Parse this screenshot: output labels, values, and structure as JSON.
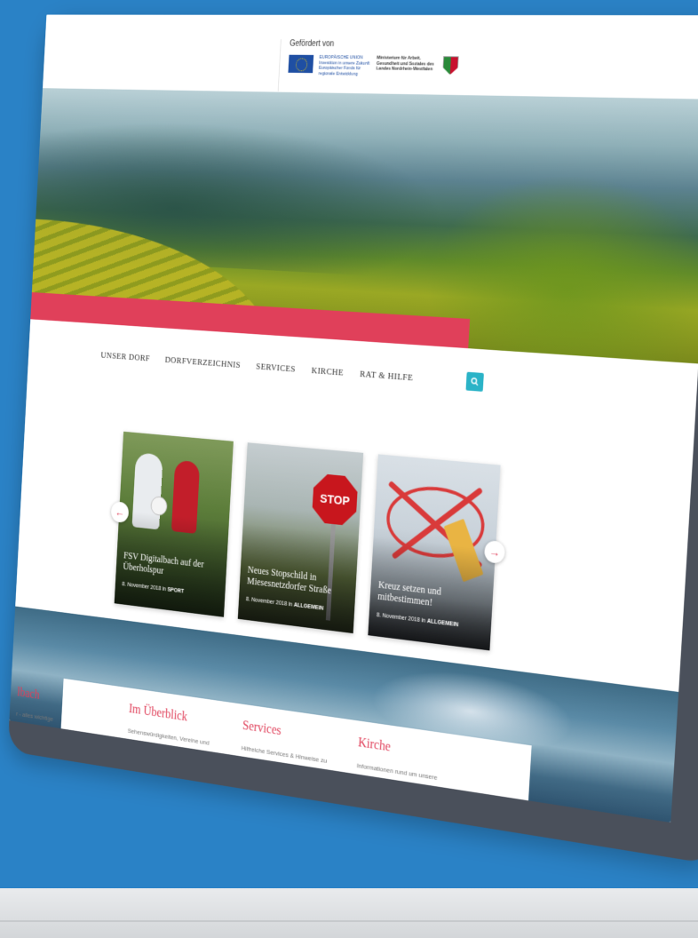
{
  "sponsor": {
    "title": "Gefördert von",
    "eu_text": "EUROPÄISCHE UNION Investition in unsere Zukunft Europäischer Fonds für regionale Entwicklung",
    "ministry_text": "Ministerium für Arbeit, Gesundheit und Soziales des Landes Nordrhein-Westfalen"
  },
  "nav": {
    "items": [
      "UNSER DORF",
      "DORFVERZEICHNIS",
      "SERVICES",
      "KIRCHE",
      "RAT & HILFE"
    ],
    "search_icon": "search-icon"
  },
  "slider": {
    "prev_icon": "arrow-left-icon",
    "next_icon": "arrow-right-icon",
    "slides": [
      {
        "title": "FSV Digitalbach auf der Überholspur",
        "date": "8. November 2018 in",
        "category": "SPORT"
      },
      {
        "title": "Neues Stopschild in Miesesnetzdorfer Straße",
        "date": "8. November 2018 in",
        "category": "ALLGEMEIN"
      },
      {
        "title": "Kreuz setzen und mitbestimmen!",
        "date": "8. November 2018 in",
        "category": "ALLGEMEIN"
      }
    ],
    "stop_text": "STOP"
  },
  "info": {
    "columns": [
      {
        "title": "lbach",
        "desc": "r - alles wichtige"
      },
      {
        "title": "Im Überblick",
        "desc": "Sehenswürdigkeiten, Vereine und"
      },
      {
        "title": "Services",
        "desc": "Hilfreiche Services & Hinweise zu"
      },
      {
        "title": "Kirche",
        "desc": "Informationen rund um unsere"
      }
    ]
  },
  "colors": {
    "background": "#2a82c6",
    "accent_red": "#e0405a",
    "accent_teal": "#2ab3c7",
    "bezel": "#4a505b"
  }
}
